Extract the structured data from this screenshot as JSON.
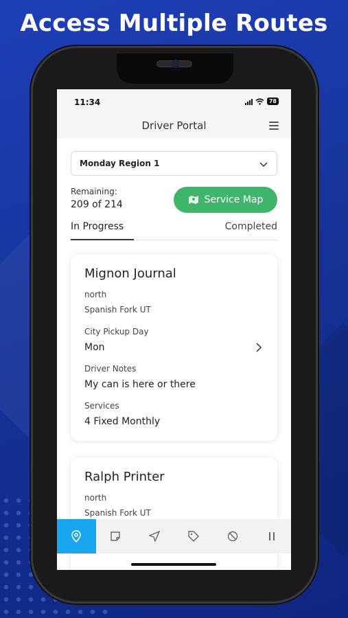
{
  "headline": "Access Multiple Routes",
  "status_bar": {
    "time": "11:34",
    "battery": "78"
  },
  "app": {
    "title": "Driver Portal"
  },
  "region_select": {
    "value": "Monday Region 1"
  },
  "remaining": {
    "label": "Remaining:",
    "count": "209 of 214"
  },
  "service_map_button": {
    "label": "Service Map"
  },
  "tabs": [
    {
      "label": "In Progress",
      "active": true
    },
    {
      "label": "Completed",
      "active": false
    }
  ],
  "cards": [
    {
      "title": "Mignon Journal",
      "direction": "north",
      "location": "Spanish Fork UT",
      "pickup_label": "City Pickup Day",
      "pickup_value": "Mon",
      "notes_label": "Driver Notes",
      "notes_value": "My can is here or there",
      "services_label": "Services",
      "services_value": "4 Fixed Monthly"
    },
    {
      "title": "Ralph Printer",
      "direction": "north",
      "location": "Spanish Fork UT"
    }
  ],
  "bottom_nav": [
    {
      "icon": "map-pin-icon",
      "active": true
    },
    {
      "icon": "note-icon",
      "active": false
    },
    {
      "icon": "send-icon",
      "active": false
    },
    {
      "icon": "tag-icon",
      "active": false
    },
    {
      "icon": "block-icon",
      "active": false
    },
    {
      "icon": "pause-icon",
      "active": false
    }
  ],
  "colors": {
    "accent_green": "#3fb56b",
    "nav_active": "#1aa6ee",
    "background_blue": "#1a3aa8"
  }
}
